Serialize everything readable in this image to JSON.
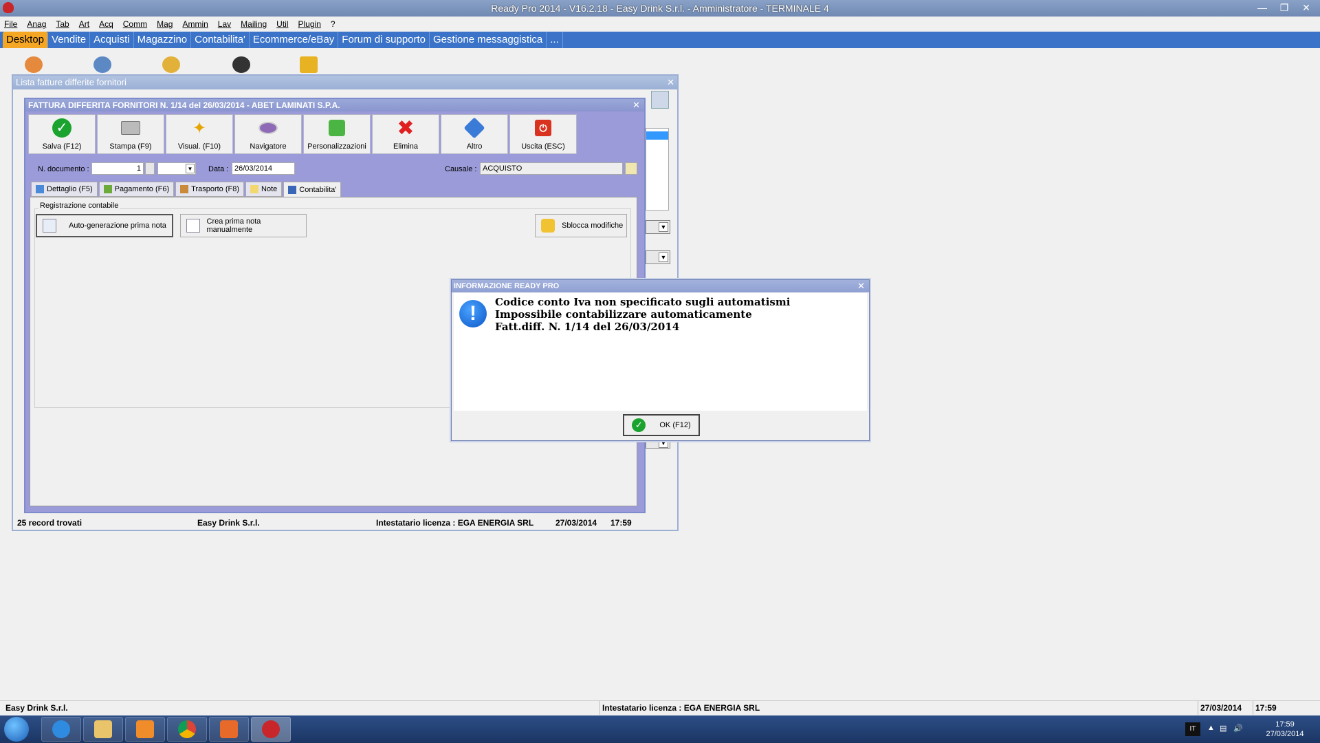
{
  "window_title": "Ready Pro 2014 - V16.2.18 - Easy Drink S.r.l. - Amministratore - TERMINALE 4",
  "menu": [
    "File",
    "Anag",
    "Tab",
    "Art",
    "Acq",
    "Comm",
    "Mag",
    "Ammin",
    "Lav",
    "Mailing",
    "Util",
    "Plugin",
    "?"
  ],
  "tabs": [
    "Desktop",
    "Vendite",
    "Acquisti",
    "Magazzino",
    "Contabilita'",
    "Ecommerce/eBay",
    "Forum di supporto",
    "Gestione messaggistica",
    "..."
  ],
  "lista_window": {
    "title": "Lista fatture differite fornitori",
    "status": {
      "records": "25 record trovati",
      "company": "Easy Drink S.r.l.",
      "license": "Intestatario licenza : EGA ENERGIA SRL",
      "date": "27/03/2014",
      "time": "17:59"
    }
  },
  "fattura_window": {
    "title": "FATTURA DIFFERITA FORNITORI N. 1/14 del 26/03/2014 - ABET LAMINATI S.P.A.",
    "toolbar": [
      {
        "label": "Salva (F12)",
        "icon": "check-icon"
      },
      {
        "label": "Stampa (F9)",
        "icon": "printer-icon"
      },
      {
        "label": "Visual. (F10)",
        "icon": "magic-wand-icon"
      },
      {
        "label": "Navigatore",
        "icon": "navigator-icon"
      },
      {
        "label": "Personalizzazioni",
        "icon": "puzzle-icon"
      },
      {
        "label": "Elimina",
        "icon": "delete-x-icon"
      },
      {
        "label": "Altro",
        "icon": "search-tag-icon"
      },
      {
        "label": "Uscita (ESC)",
        "icon": "exit-icon"
      }
    ],
    "form": {
      "num_label": "N. documento :",
      "num_value": "1",
      "data_label": "Data :",
      "data_value": "26/03/2014",
      "causale_label": "Causale :",
      "causale_value": "ACQUISTO"
    },
    "subtabs": [
      "Dettaglio (F5)",
      "Pagamento (F6)",
      "Trasporto (F8)",
      "Note",
      "Contabilita'"
    ],
    "group_label": "Registrazione contabile",
    "buttons": {
      "auto": "Auto-generazione prima nota",
      "manual": "Crea prima nota manualmente",
      "unlock": "Sblocca modifiche"
    }
  },
  "dialog": {
    "title": "INFORMAZIONE READY PRO",
    "lines": [
      "Codice conto Iva non specificato sugli automatismi",
      "Impossibile contabilizzare automaticamente",
      "Fatt.diff. N. 1/14 del 26/03/2014"
    ],
    "ok_label": "OK (F12)"
  },
  "app_status": {
    "company": "Easy Drink S.r.l.",
    "license": "Intestatario licenza : EGA ENERGIA SRL",
    "date": "27/03/2014",
    "time": "17:59"
  },
  "taskbar": {
    "lang": "IT",
    "time": "17:59",
    "date": "27/03/2014"
  },
  "colors": {
    "tab_bar": "#3a73c8",
    "active_tab": "#f5a623",
    "inner_window": "#9a9bd8",
    "dialog_icon": "#0a56c7"
  }
}
